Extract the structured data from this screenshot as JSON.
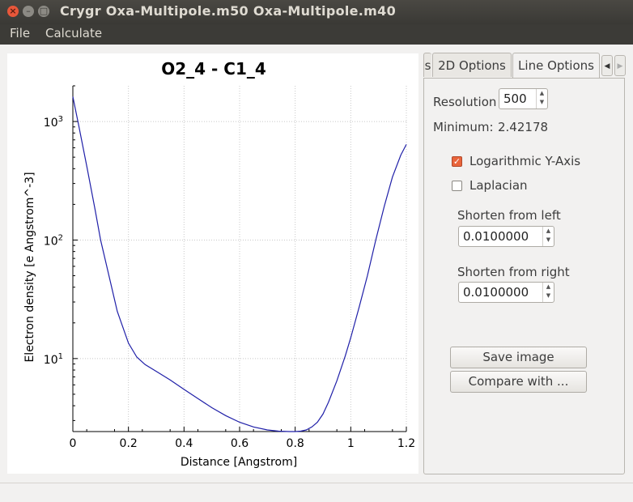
{
  "window": {
    "title": "Crygr Oxa-Multipole.m50 Oxa-Multipole.m40"
  },
  "menubar": {
    "items": [
      "File",
      "Calculate"
    ]
  },
  "tabs": {
    "partial": "s",
    "items": [
      "2D Options",
      "Line Options"
    ],
    "active": "Line Options"
  },
  "panel": {
    "resolution_label": "Resolution",
    "resolution_value": "500",
    "minimum_label": "Minimum:",
    "minimum_value": "2.42178",
    "log_y_label": "Logarithmic Y-Axis",
    "log_y_checked": true,
    "laplacian_label": "Laplacian",
    "laplacian_checked": false,
    "shorten_left_label": "Shorten from left",
    "shorten_left_value": "0.0100000",
    "shorten_right_label": "Shorten from right",
    "shorten_right_value": "0.0100000",
    "save_image_label": "Save image",
    "compare_label": "Compare with ..."
  },
  "colors": {
    "accent": "#e9643b",
    "curve": "#1f1fa8"
  },
  "chart_data": {
    "type": "line",
    "title": "O2_4 - C1_4",
    "xlabel": "Distance [Angstrom]",
    "ylabel": "Electron density [e Angstrom^-3]",
    "xlim": [
      0,
      1.2
    ],
    "ylim": [
      2.42178,
      2000
    ],
    "yscale": "log",
    "grid": true,
    "xticks": [
      "0",
      "0.2",
      "0.4",
      "0.6",
      "0.8",
      "1",
      "1.2"
    ],
    "yticks": [
      {
        "base": "10",
        "exp": "1",
        "value": 10
      },
      {
        "base": "10",
        "exp": "2",
        "value": 100
      },
      {
        "base": "10",
        "exp": "3",
        "value": 1000
      }
    ],
    "series": [
      {
        "x": [
          0.0,
          0.02,
          0.05,
          0.08,
          0.1,
          0.13,
          0.16,
          0.2,
          0.23,
          0.26,
          0.3,
          0.35,
          0.4,
          0.45,
          0.5,
          0.55,
          0.6,
          0.65,
          0.7,
          0.74,
          0.78,
          0.8,
          0.82,
          0.84,
          0.86,
          0.88,
          0.9,
          0.92,
          0.95,
          0.98,
          1.0,
          1.03,
          1.06,
          1.09,
          1.12,
          1.15,
          1.18,
          1.2
        ],
        "y": [
          1620,
          950,
          420,
          180,
          100,
          50,
          25,
          13.5,
          10.3,
          8.9,
          7.8,
          6.6,
          5.5,
          4.6,
          3.85,
          3.3,
          2.9,
          2.65,
          2.5,
          2.44,
          2.42,
          2.42,
          2.44,
          2.5,
          2.65,
          2.9,
          3.4,
          4.3,
          6.5,
          10.5,
          15,
          27,
          50,
          100,
          190,
          340,
          520,
          640
        ]
      }
    ]
  }
}
